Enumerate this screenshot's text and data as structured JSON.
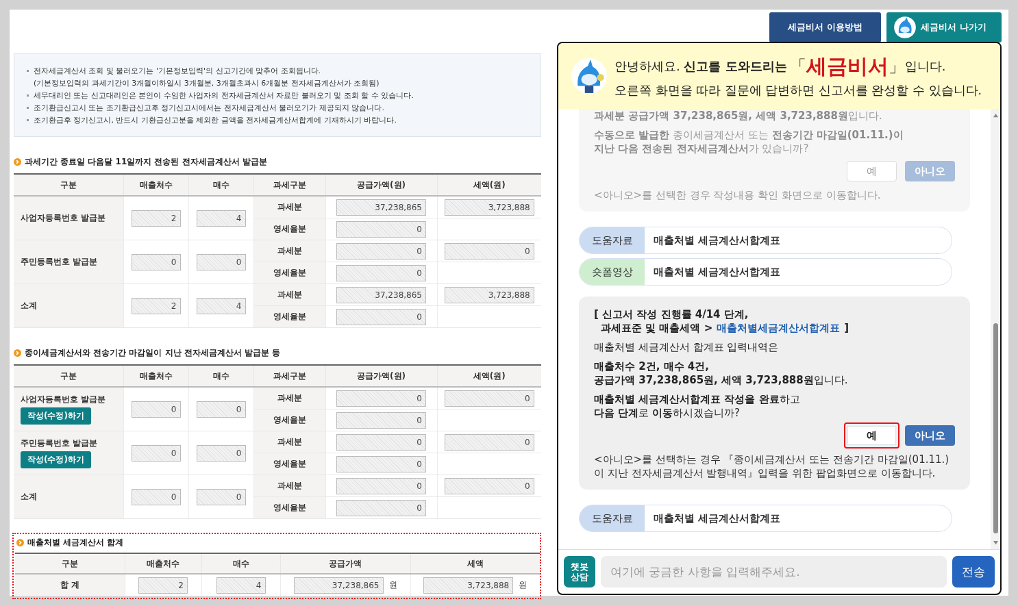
{
  "header_buttons": [
    {
      "label": "세금비서 이용방법",
      "kind": "guide"
    },
    {
      "label": "세금비서 나가기",
      "kind": "exit"
    }
  ],
  "notices": [
    {
      "text": "전자세금계산서 조회 및 불러오기는 '기본정보입력'의 신고기간에 맞추어 조회됩니다.",
      "bullet": true
    },
    {
      "text": "(기본정보입력의 과세기간이 3개월이하일시 3개월분, 3개월초과시 6개월분 전자세금계산서가 조회됨)",
      "bullet": false
    },
    {
      "text": "세무대리인 또는 신고대리인은 본인이 수임한 사업자의 전자세금계산서 자료만 불러오기 및 조회 할 수 있습니다.",
      "bullet": true
    },
    {
      "text": "조기환급신고시 또는 조기환급신고후 정기신고시에서는 전자세금계산서 불러오기가 제공되지 않습니다.",
      "bullet": true
    },
    {
      "text": "조기환급후 정기신고시, 반드시 기환급신고분을 제외한 금액을 전자세금계산서합계에 기재하시기 바랍니다.",
      "bullet": true
    }
  ],
  "sections": [
    {
      "title": "과세기간 종료일 다음달 11일까지 전송된 전자세금계산서 발급분",
      "columns": [
        "구분",
        "매출처수",
        "매수",
        "과세구분",
        "공급가액(원)",
        "세액(원)"
      ],
      "groups": [
        {
          "label": "사업자등록번호 발급분",
          "buyers": "2",
          "count": "4",
          "rows": [
            {
              "type": "과세분",
              "supply": "37,238,865",
              "tax": "3,723,888"
            },
            {
              "type": "영세율분",
              "supply": "0"
            }
          ]
        },
        {
          "label": "주민등록번호 발급분",
          "buyers": "0",
          "count": "0",
          "rows": [
            {
              "type": "과세분",
              "supply": "0",
              "tax": "0"
            },
            {
              "type": "영세율분",
              "supply": "0"
            }
          ]
        },
        {
          "label": "소계",
          "buyers": "2",
          "count": "4",
          "rows": [
            {
              "type": "과세분",
              "supply": "37,238,865",
              "tax": "3,723,888"
            },
            {
              "type": "영세율분",
              "supply": "0"
            }
          ]
        }
      ]
    },
    {
      "title": "종이세금계산서와 전송기간 마감일이 지난 전자세금계산서 발급분 등",
      "columns": [
        "구분",
        "매출처수",
        "매수",
        "과세구분",
        "공급가액(원)",
        "세액(원)"
      ],
      "groups": [
        {
          "label": "사업자등록번호 발급분",
          "action": "작성(수정)하기",
          "buyers": "0",
          "count": "0",
          "rows": [
            {
              "type": "과세분",
              "supply": "0",
              "tax": "0"
            },
            {
              "type": "영세율분",
              "supply": "0"
            }
          ]
        },
        {
          "label": "주민등록번호 발급분",
          "action": "작성(수정)하기",
          "buyers": "0",
          "count": "0",
          "rows": [
            {
              "type": "과세분",
              "supply": "0",
              "tax": "0"
            },
            {
              "type": "영세율분",
              "supply": "0"
            }
          ]
        },
        {
          "label": "소계",
          "buyers": "0",
          "count": "0",
          "rows": [
            {
              "type": "과세분",
              "supply": "0",
              "tax": "0"
            },
            {
              "type": "영세율분",
              "supply": "0"
            }
          ]
        }
      ]
    }
  ],
  "summary": {
    "title": "매출처별 세금계산서 합계",
    "highlighted": true,
    "columns": [
      "구분",
      "매출처수",
      "매수",
      "공급가액",
      "세액"
    ],
    "row": {
      "label": "합 계",
      "buyers": "2",
      "count": "4",
      "supply": "37,238,865",
      "supply_unit": "원",
      "tax": "3,723,888",
      "tax_unit": "원"
    }
  },
  "chat": {
    "banner": {
      "intro": "안녕하세요. **신고를 도와드리는**",
      "open": "「",
      "brand": "세금비서",
      "close": "」",
      "outro": "입니다.",
      "subtitle": "오른쪽 화면을 따라 질문에 답변하면 신고서를 완성할 수 있습니다."
    },
    "messages": [
      {
        "kind": "bubble",
        "faded": true,
        "paragraphs": [
          [
            "**과세분 공급가액 37,238,865원, 세액 3,723,888원**입니다."
          ],
          [
            "**수동으로 발급한** 종이세금계산서 또는 **전송기간 마감일(01.11.)이**",
            "**지난 다음 전송된 전자세금계산서**가 있습니까?"
          ]
        ],
        "buttons": [
          {
            "label": "예",
            "kind": "yes",
            "highlighted": false
          },
          {
            "label": "아니오",
            "kind": "no",
            "highlighted": false
          }
        ],
        "note": [
          "<아니오>를 선택한 경우 작성내용 확인 화면으로 이동합니다."
        ]
      },
      {
        "kind": "links",
        "items": [
          {
            "tag": "도움자료",
            "kind": "doc",
            "title": "매출처별 세금계산서합계표"
          },
          {
            "tag": "숏폼영상",
            "kind": "video",
            "title": "매출처별 세금계산서합계표"
          }
        ]
      },
      {
        "kind": "bubble",
        "faded": false,
        "progress": {
          "line1": "[ 신고서 작성 진행률 4/14 단계,",
          "path": "과세표준 및 매출세액 >",
          "link": "매출처별세금계산서합계표",
          "close": "]"
        },
        "paragraphs": [
          [
            "매출처별 세금계산서 합계표 입력내역은"
          ],
          [
            "**매출처수 2건, 매수 4건,**",
            "**공급가액 37,238,865원, 세액 3,723,888원**입니다."
          ],
          [
            "**매출처별 세금계산서합계표 작성을 완료**하고",
            "**다음 단계**로 **이동**하시겠습니까?"
          ]
        ],
        "buttons": [
          {
            "label": "예",
            "kind": "yes",
            "highlighted": true
          },
          {
            "label": "아니오",
            "kind": "no",
            "highlighted": false
          }
        ],
        "note": [
          "<아니오>를 선택하는 경우 『종이세금계산서 또는 전송기간 마감일(01.11.)",
          "이 지난 전자세금계산서 발행내역』입력을 위한 팝업화면으로 이동합니다."
        ]
      },
      {
        "kind": "links",
        "items": [
          {
            "tag": "도움자료",
            "kind": "doc",
            "title": "매출처별 세금계산서합계표"
          }
        ]
      }
    ],
    "chatbot_button": "챗봇 상담",
    "input": {
      "placeholder": "여기에 궁금한 사항을 입력해주세요."
    },
    "send_button": "전송"
  }
}
